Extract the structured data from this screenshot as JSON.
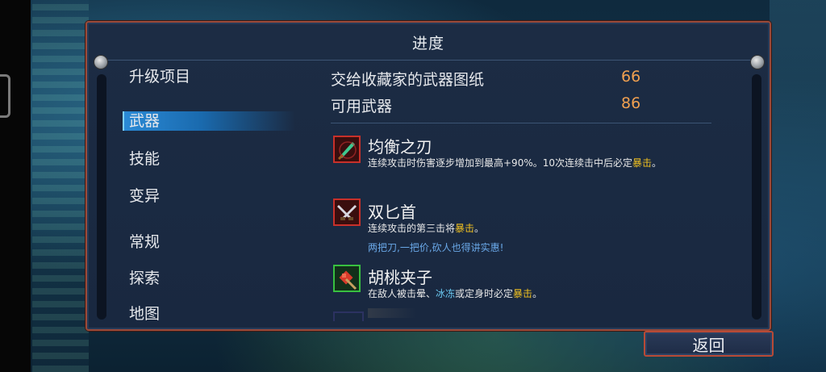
{
  "panel": {
    "title": "进度"
  },
  "sidebar": {
    "heading": "升级项目",
    "items": [
      {
        "label": "武器",
        "active": true
      },
      {
        "label": "技能"
      },
      {
        "label": "变异"
      },
      {
        "label": "常规"
      },
      {
        "label": "探索"
      },
      {
        "label": "地图"
      }
    ]
  },
  "summary": {
    "rows": [
      {
        "label": "交给收藏家的武器图纸",
        "value": "66"
      },
      {
        "label": "可用武器",
        "value": "86"
      }
    ]
  },
  "weapons": [
    {
      "name": "均衡之刃",
      "icon": "balanced-blade-icon",
      "desc_main": "连续攻击时伤害逐步增加到最高+90%。10次连续击中后必定",
      "desc_hl": "暴击",
      "desc_end": "。"
    },
    {
      "name": "双匕首",
      "icon": "twin-daggers-icon",
      "desc_main": "连续攻击的第三击将",
      "desc_hl": "暴击",
      "desc_end": "。",
      "quote": "两把刀,一把价,砍人也得讲实惠!"
    },
    {
      "name": "胡桃夹子",
      "icon": "nutcracker-icon",
      "desc_a": "在敌人被击晕、",
      "desc_blue": "冰冻",
      "desc_b": "或定身时必定",
      "desc_hl": "暴击",
      "desc_end": "。"
    }
  ],
  "buttons": {
    "back": "返回"
  },
  "colors": {
    "accent_value": "#f0a050",
    "crit_gold": "#f0c020",
    "freeze_blue": "#6ac8f0",
    "frame_red": "#b84a36"
  }
}
